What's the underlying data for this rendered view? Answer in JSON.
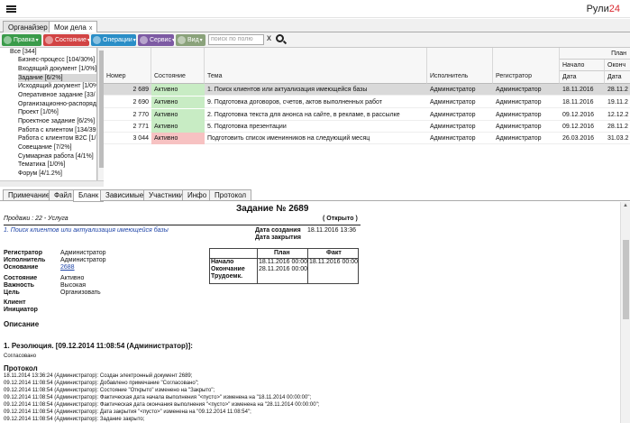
{
  "brand": {
    "name": "Рули",
    "num": "24"
  },
  "tabs": [
    {
      "label": "Органайзер"
    },
    {
      "label": "Мои дела",
      "close": "x"
    }
  ],
  "toolbar": {
    "buttons": [
      {
        "label": "Правка",
        "color": "#3a9b4a"
      },
      {
        "label": "Состояние",
        "color": "#d24444"
      },
      {
        "label": "Операции",
        "color": "#2a8ec7"
      },
      {
        "label": "Сервис",
        "color": "#7d5aa3"
      },
      {
        "label": "Вид",
        "color": "#8aa27a"
      }
    ],
    "caret": "▾",
    "search_placeholder": "поиск по полю",
    "clear_label": "x"
  },
  "tree": [
    {
      "label": "Все [344]"
    },
    {
      "label": "Бизнес-процесс [104/30%]"
    },
    {
      "label": "Входящий документ [1/0%]"
    },
    {
      "label": "Задание [6/2%]"
    },
    {
      "label": "Исходящий документ [1/0%]"
    },
    {
      "label": "Оперативное задание [33/"
    },
    {
      "label": "Организационно-распоряд"
    },
    {
      "label": "Проект [1/0%]"
    },
    {
      "label": "Проектное задание [6/2%]"
    },
    {
      "label": "Работа с клиентом [134/39"
    },
    {
      "label": "Работа с клиентом B2C [1/"
    },
    {
      "label": "Совещание [7/2%]"
    },
    {
      "label": "Суммарная работа [4/1%]"
    },
    {
      "label": "Тематика [1/0%]"
    },
    {
      "label": "Форум [4/1.2%]"
    }
  ],
  "grid": {
    "columns": {
      "number": "Номер",
      "state": "Состояние",
      "subject": "Тема",
      "executor": "Исполнитель",
      "registrar": "Регистратор",
      "date": "Дата",
      "plan": "План",
      "start": "Начало",
      "end": "Оконч",
      "date2": "Дата"
    },
    "rows": [
      {
        "number": "2 689",
        "state": "Активно",
        "subject": "1. Поиск клиентов или актуализация имеющейся базы",
        "executor": "Администратор",
        "registrar": "Администратор",
        "date": "18.11.2016",
        "date2": "28.11.2"
      },
      {
        "number": "2 690",
        "state": "Активно",
        "subject": "9. Подготовка договоров, счетов, актов выполненных работ",
        "executor": "Администратор",
        "registrar": "Администратор",
        "date": "18.11.2016",
        "date2": "19.11.2"
      },
      {
        "number": "2 770",
        "state": "Активно",
        "subject": "2. Подготовка текста для анонса на сайте, в рекламе, в рассылке",
        "executor": "Администратор",
        "registrar": "Администратор",
        "date": "09.12.2016",
        "date2": "12.12.2"
      },
      {
        "number": "2 771",
        "state": "Активно",
        "subject": "5. Подготовка презентации",
        "executor": "Администратор",
        "registrar": "Администратор",
        "date": "09.12.2016",
        "date2": "28.11.2"
      },
      {
        "number": "3 044",
        "state": "Активно",
        "subject": "Подготовить список именинников на следующий месяц",
        "executor": "Администратор",
        "registrar": "Администратор",
        "date": "26.03.2016",
        "date2": "31.03.2"
      }
    ]
  },
  "detail_tabs": [
    "Примечание",
    "Файл",
    "Бланк",
    "Зависимые",
    "Участники",
    "Инфо",
    "Протокол"
  ],
  "doc": {
    "title": "Задание № 2689",
    "sales": "Продажи : 22 - Услуга",
    "open_status": "( Открыто )",
    "task_link": "1. Поиск клиентов или актуализация имеющейся базы",
    "created_label": "Дата создания",
    "created_value": "18.11.2016 13:36",
    "closed_label": "Дата закрытия",
    "fields": [
      {
        "label": "Регистратор",
        "value": "Администратор"
      },
      {
        "label": "Исполнитель",
        "value": "Администратор"
      },
      {
        "label": "Основание",
        "value": "2688"
      },
      {
        "label": "Состояние",
        "value": "Активно"
      },
      {
        "label": "Важность",
        "value": "Высокая"
      },
      {
        "label": "Цель",
        "value": "Организовать"
      },
      {
        "label": "Клиент",
        "value": ""
      },
      {
        "label": "Инициатор",
        "value": ""
      }
    ],
    "plan_table": {
      "head_plan": "План",
      "head_fact": "Факт",
      "rows": [
        {
          "label": "Начало",
          "plan": "18.11.2016 00:00",
          "fact": "18.11.2016 00:00"
        },
        {
          "label": "Окончание",
          "plan": "28.11.2016 00:00",
          "fact": ""
        },
        {
          "label": "Трудоемк.",
          "plan": "",
          "fact": ""
        }
      ]
    },
    "description_label": "Описание",
    "resolution": "1. Резолюция. [09.12.2014 11:08:54 (Администратор)]:",
    "resolution_text": "Согласовано",
    "protocol_label": "Протокол",
    "protocol": [
      "18.11.2014 13:36:24 (Администратор): Создан электронный документ 2689;",
      "09.12.2014 11:08:54 (Администратор): Добавлено примечание \"Согласовано\";",
      "09.12.2014 11:08:54 (Администратор): Состояние \"Открыто\" изменено на \"Закрыто\";",
      "09.12.2014 11:08:54 (Администратор): Фактическая дата начала выполнения \"<пусто>\" изменена на \"18.11.2014 00:00:00\";",
      "09.12.2014 11:08:54 (Администратор): Фактическая дата окончания выполнения \"<пусто>\" изменена на \"28.11.2014 00:00:00\";",
      "09.12.2014 11:08:54 (Администратор): Дата закрытия \"<пусто>\" изменена на \"09.12.2014 11:08:54\";",
      "09.12.2014 11:08:54 (Администратор): Задание закрыто;"
    ]
  }
}
